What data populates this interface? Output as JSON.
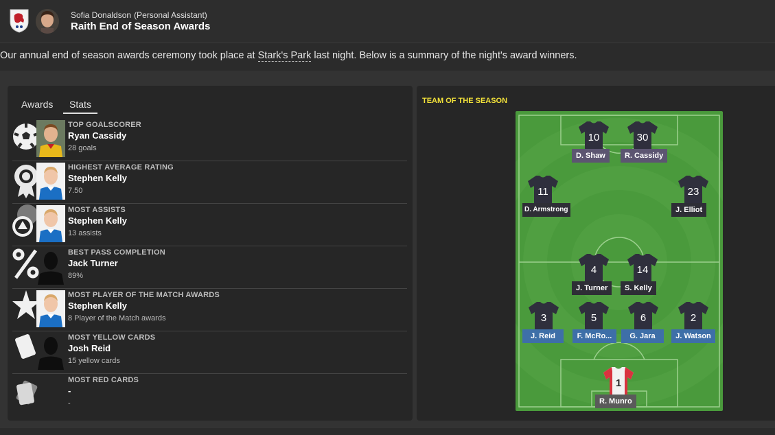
{
  "header": {
    "sender_name": "Sofia Donaldson",
    "sender_role": "(Personal Assistant)",
    "title": "Raith End of Season Awards"
  },
  "intro": {
    "before": "Our annual end of season awards ceremony took place at ",
    "link": "Stark's Park",
    "after": " last night. Below is a summary of the night's award winners."
  },
  "tabs": [
    {
      "label": "Awards"
    },
    {
      "label": "Stats"
    }
  ],
  "awards": [
    {
      "category": "TOP GOALSCORER",
      "winner": "Ryan Cassidy",
      "value": "28 goals",
      "icon": "football-icon"
    },
    {
      "category": "HIGHEST AVERAGE RATING",
      "winner": "Stephen Kelly",
      "value": "7.50",
      "icon": "rating-badge-icon"
    },
    {
      "category": "MOST ASSISTS",
      "winner": "Stephen Kelly",
      "value": "13 assists",
      "icon": "assist-icon"
    },
    {
      "category": "BEST PASS COMPLETION",
      "winner": "Jack Turner",
      "value": "89%",
      "icon": "percent-icon"
    },
    {
      "category": "MOST PLAYER OF THE MATCH AWARDS",
      "winner": "Stephen Kelly",
      "value": "8 Player of the Match awards",
      "icon": "star-icon"
    },
    {
      "category": "MOST YELLOW CARDS",
      "winner": "Josh Reid",
      "value": "15 yellow cards",
      "icon": "yellow-card-icon"
    },
    {
      "category": "MOST RED CARDS",
      "winner": "-",
      "value": "-",
      "icon": "red-card-icon"
    }
  ],
  "team": {
    "title": "TEAM OF THE SEASON",
    "players": [
      {
        "number": "10",
        "name": "D. Shaw",
        "role": "striker"
      },
      {
        "number": "30",
        "name": "R. Cassidy",
        "role": "striker"
      },
      {
        "number": "11",
        "name": "D. Armstrong",
        "role": "winger"
      },
      {
        "number": "23",
        "name": "J. Elliot",
        "role": "winger"
      },
      {
        "number": "4",
        "name": "J. Turner",
        "role": "midfielder"
      },
      {
        "number": "14",
        "name": "S. Kelly",
        "role": "midfielder"
      },
      {
        "number": "3",
        "name": "J. Reid",
        "role": "defender"
      },
      {
        "number": "5",
        "name": "F. McRo...",
        "role": "defender"
      },
      {
        "number": "6",
        "name": "G. Jara",
        "role": "defender"
      },
      {
        "number": "2",
        "name": "J. Watson",
        "role": "defender"
      },
      {
        "number": "1",
        "name": "R. Munro",
        "role": "goalkeeper"
      }
    ]
  },
  "colors": {
    "pitch_green": "#4a9a3c",
    "shirt": "#2f2f3d",
    "gk_shirt": "#f2f2f2",
    "tots_title": "#f3e23a"
  }
}
